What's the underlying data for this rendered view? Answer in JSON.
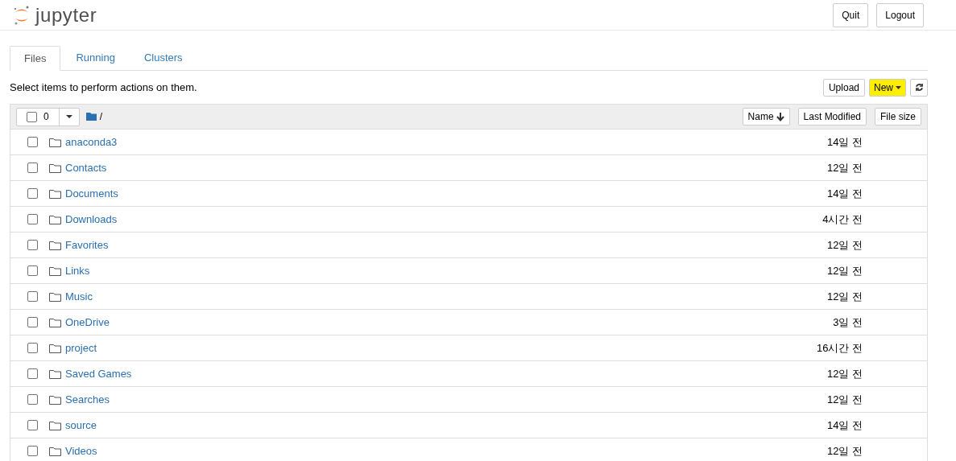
{
  "header": {
    "logo_text": "jupyter",
    "buttons": [
      "Quit",
      "Logout"
    ]
  },
  "tabs": [
    {
      "label": "Files",
      "selected": true
    },
    {
      "label": "Running",
      "selected": false
    },
    {
      "label": "Clusters",
      "selected": false
    }
  ],
  "toolbar": {
    "hint": "Select items to perform actions on them.",
    "upload": "Upload",
    "new": "New",
    "new_highlighted": true
  },
  "list_header": {
    "select_all_checked": false,
    "selected_count": "0",
    "path": "/",
    "sort_buttons": [
      {
        "label": "Name",
        "sorted": true
      },
      {
        "label": "Last Modified",
        "sorted": false
      },
      {
        "label": "File size",
        "sorted": false
      }
    ]
  },
  "items": [
    {
      "name": "anaconda3",
      "modified": "14일 전",
      "checked": false
    },
    {
      "name": "Contacts",
      "modified": "12일 전",
      "checked": false
    },
    {
      "name": "Documents",
      "modified": "14일 전",
      "checked": false
    },
    {
      "name": "Downloads",
      "modified": "4시간 전",
      "checked": false
    },
    {
      "name": "Favorites",
      "modified": "12일 전",
      "checked": false
    },
    {
      "name": "Links",
      "modified": "12일 전",
      "checked": false
    },
    {
      "name": "Music",
      "modified": "12일 전",
      "checked": false
    },
    {
      "name": "OneDrive",
      "modified": "3일 전",
      "checked": false
    },
    {
      "name": "project",
      "modified": "16시간 전",
      "checked": false
    },
    {
      "name": "Saved Games",
      "modified": "12일 전",
      "checked": false
    },
    {
      "name": "Searches",
      "modified": "12일 전",
      "checked": false
    },
    {
      "name": "source",
      "modified": "14일 전",
      "checked": false
    },
    {
      "name": "Videos",
      "modified": "12일 전",
      "checked": false
    }
  ]
}
